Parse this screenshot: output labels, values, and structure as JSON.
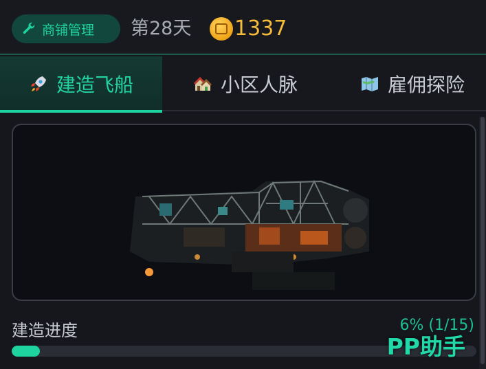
{
  "header": {
    "shop_button_label": "商铺管理",
    "day_label": "第28天",
    "coins": "1337"
  },
  "tabs": [
    {
      "label": "建造飞船",
      "icon": "rocket-icon",
      "active": true
    },
    {
      "label": "小区人脉",
      "icon": "houses-icon",
      "active": false
    },
    {
      "label": "雇佣探险",
      "icon": "map-icon",
      "active": false
    }
  ],
  "build": {
    "progress_label": "建造进度",
    "progress_text": "6% (1/15)",
    "progress_fraction": 0.06
  },
  "watermark": "PP助手",
  "colors": {
    "accent": "#1ed3a0",
    "coin": "#f6bb3a",
    "background": "#15171d"
  }
}
